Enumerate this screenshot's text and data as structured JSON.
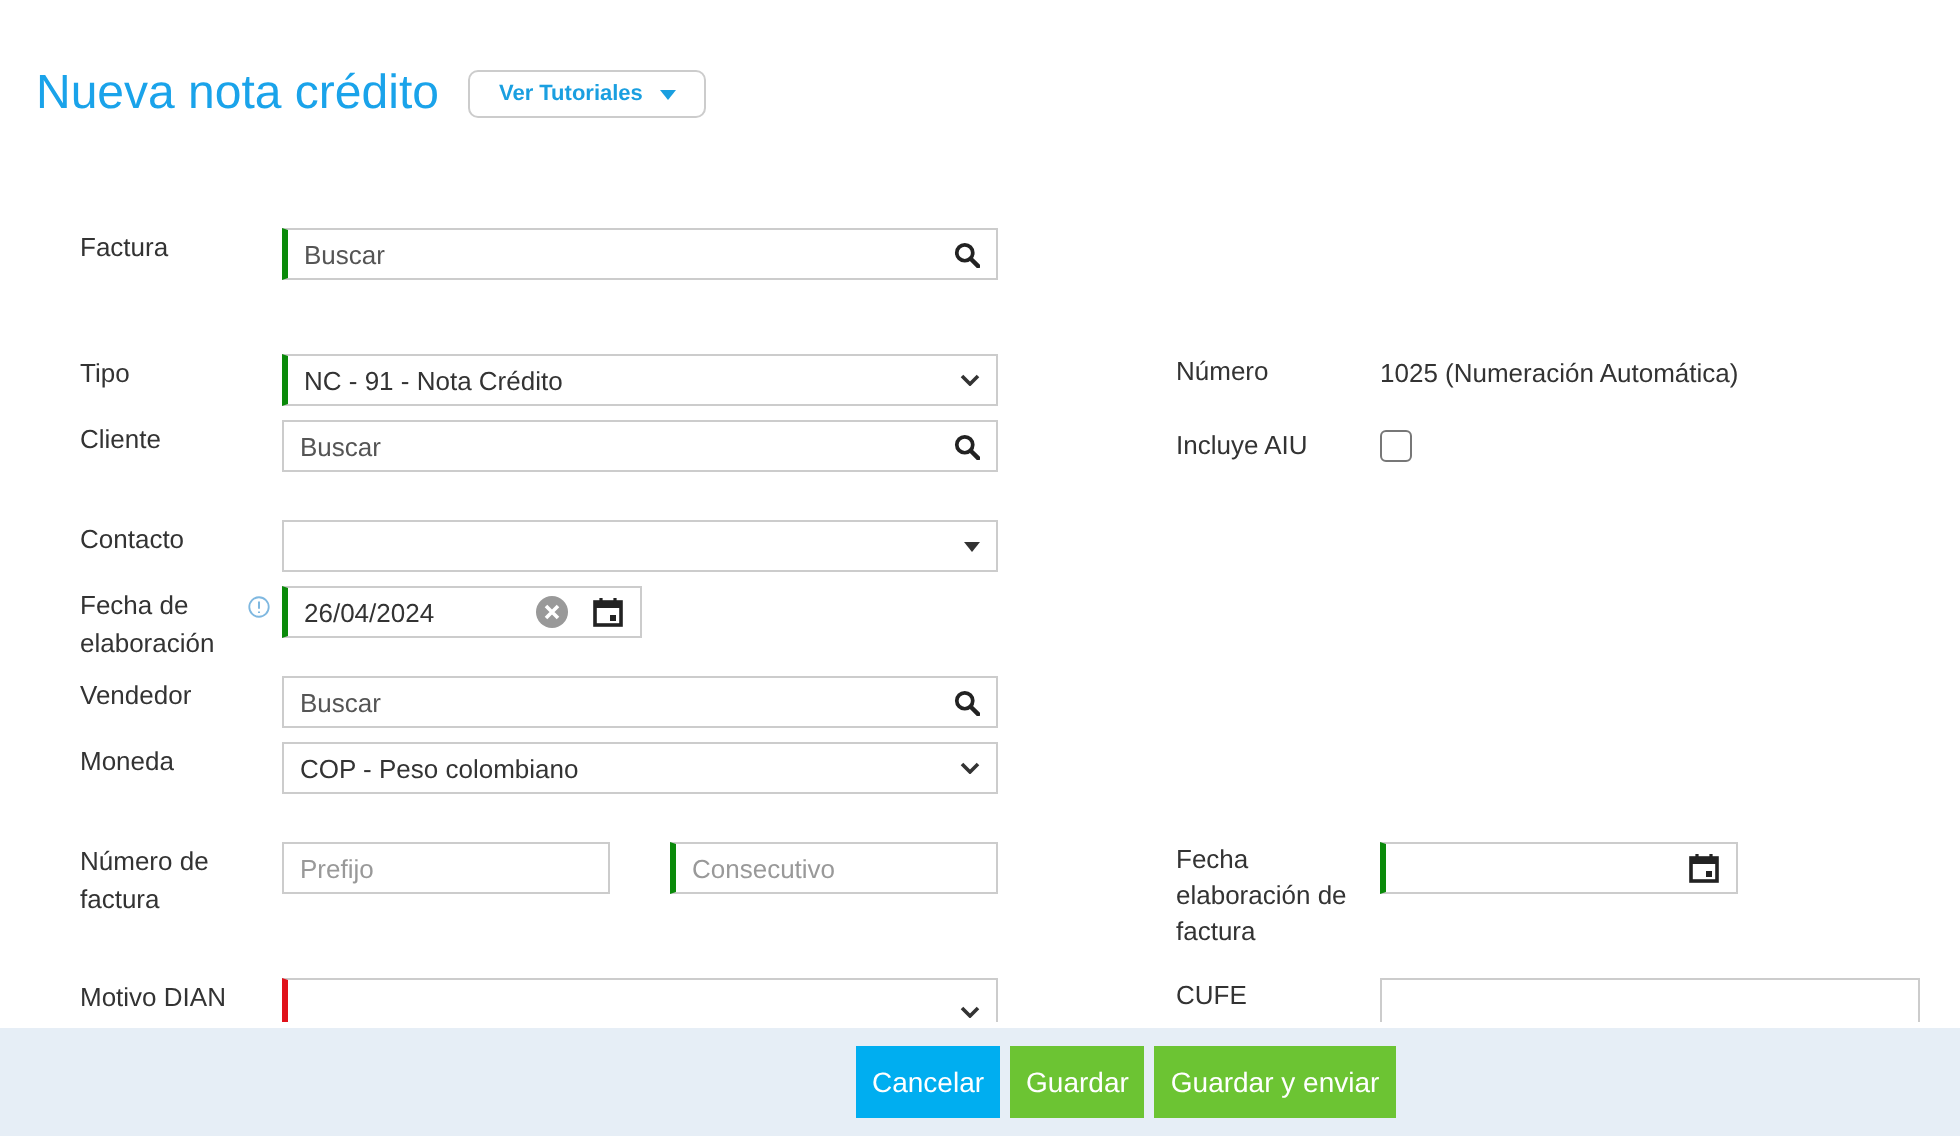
{
  "title": "Nueva nota crédito",
  "tutorials_button": {
    "label": "Ver Tutoriales"
  },
  "sections": [
    {
      "left": [
        {
          "label": "Factura",
          "kind": "search",
          "placeholder": "Buscar",
          "required": true
        }
      ]
    },
    {
      "left": [
        {
          "label": "Tipo",
          "kind": "select",
          "value": "NC - 91 - Nota Crédito",
          "required": true
        },
        {
          "label": "Cliente",
          "kind": "search",
          "placeholder": "Buscar",
          "required": false
        }
      ],
      "right": [
        {
          "label": "Número",
          "kind": "text",
          "value": "1025 (Numeración Automática)"
        },
        {
          "label": "Incluye AIU",
          "kind": "checkbox",
          "checked": false
        }
      ]
    },
    {
      "left": [
        {
          "label": "Contacto",
          "kind": "combo",
          "required": false
        },
        {
          "label": "Fecha de elaboración",
          "kind": "date",
          "info": true,
          "value": "26/04/2024",
          "required": true
        },
        {
          "label": "Vendedor",
          "kind": "search",
          "placeholder": "Buscar",
          "required": false
        },
        {
          "label": "Moneda",
          "kind": "select",
          "value": "COP - Peso colombiano",
          "required": false
        }
      ]
    },
    {
      "left": [
        {
          "label": "Número de factura",
          "kind": "pair",
          "parts": [
            {
              "placeholder": "Prefijo",
              "required": false
            },
            {
              "placeholder": "Consecutivo",
              "required": true
            }
          ]
        }
      ],
      "right": [
        {
          "label": "Fecha elaboración de factura",
          "kind": "date",
          "required": true
        }
      ]
    },
    {
      "left": [
        {
          "label": "Motivo DIAN",
          "kind": "select",
          "invalid": true
        }
      ],
      "right": [
        {
          "label": "CUFE",
          "kind": "textarea"
        }
      ]
    }
  ],
  "footer_buttons": [
    {
      "label": "Cancelar",
      "kind": "cancel"
    },
    {
      "label": "Guardar",
      "kind": "primary"
    },
    {
      "label": "Guardar y enviar",
      "kind": "primary"
    }
  ]
}
